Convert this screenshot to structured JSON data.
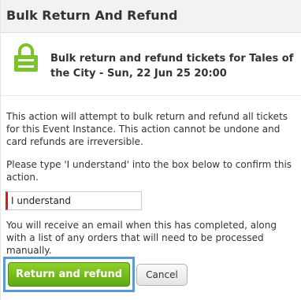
{
  "dialog": {
    "title": "Bulk Return And Refund",
    "banner": {
      "icon": "lock-icon",
      "icon_color": "#7cc22b",
      "text": "Bulk return and refund tickets for Tales of the City - Sun, 22 Jun 25 20:00"
    },
    "warning_text": "This action will attempt to bulk return and refund all tickets for this Event Instance. This action cannot be undone and card refunds are irreversible.",
    "confirm_instruction": "Please type 'I understand' into the box below to confirm this action.",
    "confirm_input": {
      "value": "I understand"
    },
    "email_notice": "You will receive an email when this has completed, along with a list of any orders that will need to be processed manually.",
    "buttons": {
      "confirm_label": "Return and refund",
      "cancel_label": "Cancel"
    },
    "colors": {
      "accent_green": "#6cb91b",
      "input_marker_red": "#d91e18",
      "focus_blue": "#5b9bd5"
    }
  }
}
